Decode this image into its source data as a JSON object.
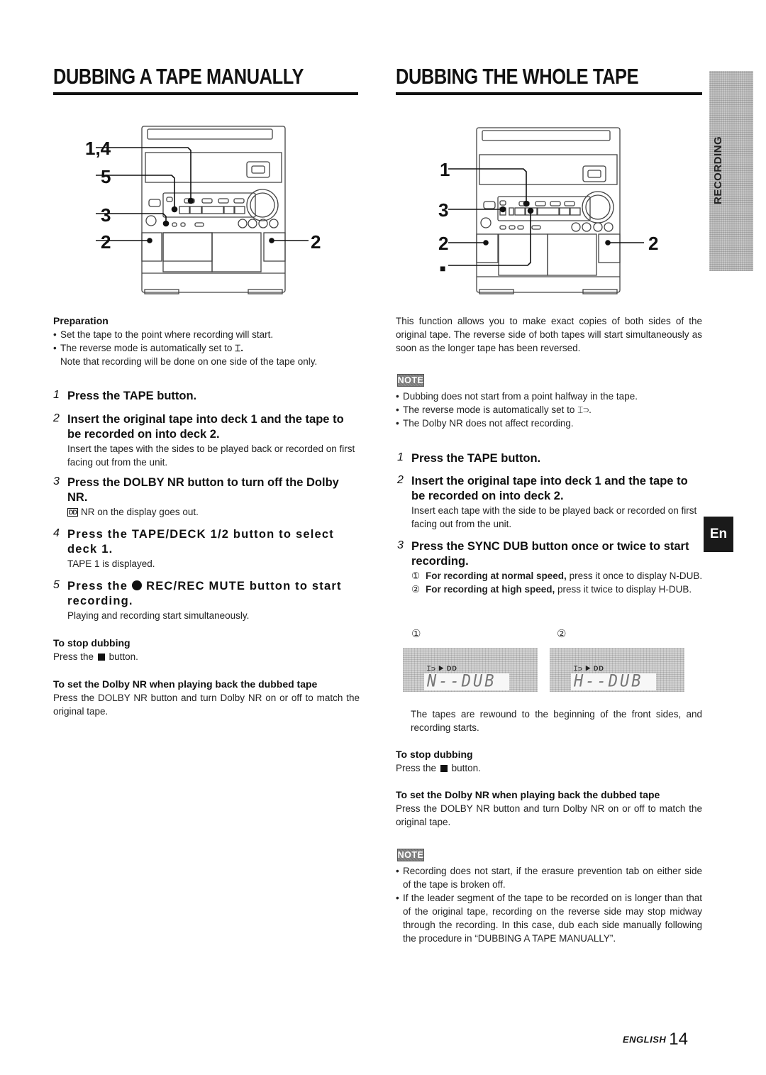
{
  "left": {
    "title": "DUBBING A TAPE MANUALLY",
    "diagram_callouts": [
      "1,4",
      "5",
      "3",
      "2",
      "2"
    ],
    "preparation": {
      "heading": "Preparation",
      "bullets": [
        "Set the tape to the point where recording will start.",
        "The reverse mode is automatically set to"
      ],
      "reverse_symbol": "⌶.",
      "note": "Note that recording will be done on one side of the tape only."
    },
    "steps": [
      {
        "num": "1",
        "head": "Press the TAPE button.",
        "body": ""
      },
      {
        "num": "2",
        "head": "Insert the original tape into deck 1 and the tape to be recorded on into deck 2.",
        "body": "Insert the tapes with the sides to be played back or recorded on first facing out from the unit."
      },
      {
        "num": "3",
        "head": "Press the DOLBY NR button to turn off the Dolby NR.",
        "body_symbol": "DD",
        "body": "NR on the display goes out."
      },
      {
        "num": "4",
        "head": "Press the TAPE/DECK 1/2 button to select deck 1.",
        "body": "TAPE 1 is displayed."
      },
      {
        "num": "5",
        "head_pre": "Press the",
        "head_post": "REC/REC MUTE button to start recording.",
        "body": "Playing and recording start simultaneously."
      }
    ],
    "stop": {
      "heading": "To stop dubbing",
      "pre": "Press the",
      "post": "button."
    },
    "dolby": {
      "heading": "To set the Dolby NR when playing back the dubbed tape",
      "body": "Press the DOLBY NR button and turn Dolby NR on or off to match the original tape."
    }
  },
  "right": {
    "title": "DUBBING THE WHOLE TAPE",
    "diagram_callouts": [
      "1",
      "3",
      "2",
      "■",
      "2"
    ],
    "intro": "This function allows you to make exact copies of both sides of the original tape. The reverse side of both tapes will start simultaneously as soon as the longer tape has been reversed.",
    "note1": {
      "badge": "NOTE",
      "bullets": [
        "Dubbing does not start from a point halfway in the tape.",
        "The reverse mode is automatically set to ⌶⊃.",
        "The Dolby NR does not affect recording."
      ]
    },
    "steps": [
      {
        "num": "1",
        "head": "Press the TAPE button.",
        "body": ""
      },
      {
        "num": "2",
        "head": "Insert the original tape into deck 1 and the tape to be recorded on into deck 2.",
        "body": "Insert each tape with the side to be played back or recorded on first facing out from the unit."
      },
      {
        "num": "3",
        "head": "Press the SYNC DUB button once or twice to start recording.",
        "options": [
          {
            "marker": "①",
            "bold": "For recording at normal speed,",
            "text": "press it once to display N-DUB."
          },
          {
            "marker": "②",
            "bold": "For recording at high speed,",
            "text": "press it twice to display H-DUB."
          }
        ]
      }
    ],
    "displays": [
      {
        "marker": "①",
        "indicator": "⌶⊃ ▶ DD",
        "text": "N--DUB"
      },
      {
        "marker": "②",
        "indicator": "⌶⊃ ▶ DD",
        "text": "H--DUB"
      }
    ],
    "after_displays": "The tapes are rewound to the beginning of the front sides, and recording starts.",
    "stop": {
      "heading": "To stop dubbing",
      "pre": "Press the",
      "post": "button."
    },
    "dolby": {
      "heading": "To set the Dolby NR when playing back the dubbed tape",
      "body": "Press the DOLBY NR button and turn Dolby NR on or off to match the original tape."
    },
    "note2": {
      "badge": "NOTE",
      "bullets": [
        "Recording does not start, if the erasure prevention tab on either side of the tape is broken off.",
        "If the leader segment of the tape to be recorded on is longer than that of the original tape, recording on the reverse side may stop midway through the recording.  In this case, dub each side manually following the procedure in  “DUBBING A TAPE MANUALLY”."
      ]
    }
  },
  "side_tab": {
    "label": "RECORDING",
    "lang": "En"
  },
  "footer": {
    "language": "ENGLISH",
    "page": "14"
  }
}
